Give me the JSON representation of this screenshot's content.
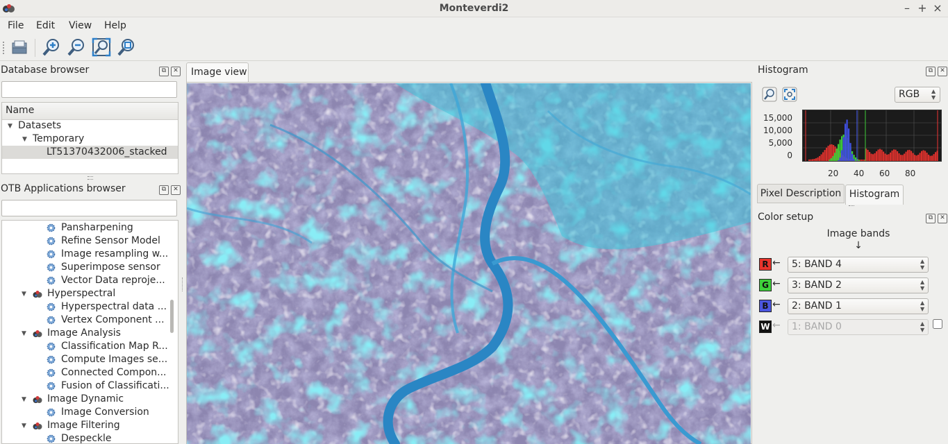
{
  "window": {
    "title": "Monteverdi2",
    "minimize": "–",
    "maximize": "+",
    "close": "×"
  },
  "menu": [
    "File",
    "Edit",
    "View",
    "Help"
  ],
  "toolbar": {
    "icons": [
      "open-icon",
      "zoom-in-icon",
      "zoom-out-icon",
      "zoom-fit-icon",
      "zoom-full-icon"
    ]
  },
  "database_browser": {
    "title": "Database browser",
    "search_value": "",
    "column_header": "Name",
    "tree": {
      "datasets": "Datasets",
      "temporary": "Temporary",
      "file": "LT51370432006_stacked"
    }
  },
  "otb_browser": {
    "title": "OTB Applications browser",
    "search_value": "",
    "items": [
      {
        "label": "Pansharpening",
        "level": 2
      },
      {
        "label": "Refine Sensor Model",
        "level": 2
      },
      {
        "label": "Image resampling w...",
        "level": 2
      },
      {
        "label": "Superimpose sensor",
        "level": 2
      },
      {
        "label": "Vector Data reproje...",
        "level": 2
      },
      {
        "label": "Hyperspectral",
        "level": 1
      },
      {
        "label": "Hyperspectral data ...",
        "level": 2
      },
      {
        "label": "Vertex Component ...",
        "level": 2
      },
      {
        "label": "Image Analysis",
        "level": 1
      },
      {
        "label": "Classification Map R...",
        "level": 2
      },
      {
        "label": "Compute Images se...",
        "level": 2
      },
      {
        "label": "Connected Compon...",
        "level": 2
      },
      {
        "label": "Fusion of Classificati...",
        "level": 2
      },
      {
        "label": "Image Dynamic",
        "level": 1
      },
      {
        "label": "Image Conversion",
        "level": 2
      },
      {
        "label": "Image Filtering",
        "level": 1
      },
      {
        "label": "Despeckle",
        "level": 2
      }
    ]
  },
  "image_view": {
    "tab_label": "Image view"
  },
  "histogram": {
    "title": "Histogram",
    "mode": "RGB",
    "y_ticks": [
      "15,000",
      "10,000",
      "5,000",
      "0"
    ],
    "x_ticks": [
      "20",
      "40",
      "60",
      "80"
    ]
  },
  "tabs": {
    "pixel_description": "Pixel Description",
    "histogram": "Histogram"
  },
  "color_setup": {
    "title": "Color setup",
    "bands_header": "Image bands",
    "down_arrow": "↓",
    "left_arrow": "←",
    "channels": [
      {
        "letter": "R",
        "color": "#e8342c",
        "value": "5: BAND 4",
        "enabled": true
      },
      {
        "letter": "G",
        "color": "#3ed13a",
        "value": "3: BAND 2",
        "enabled": true
      },
      {
        "letter": "B",
        "color": "#4b56e0",
        "value": "2: BAND 1",
        "enabled": true
      },
      {
        "letter": "W",
        "color": "#111111",
        "value": "1: BAND 0",
        "enabled": false
      }
    ]
  }
}
